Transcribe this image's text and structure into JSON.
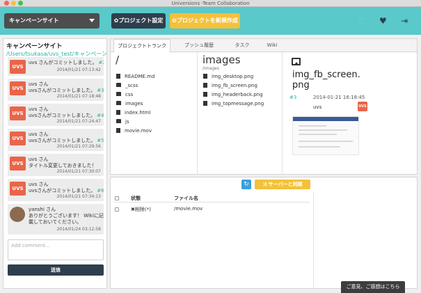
{
  "window": {
    "title": "Universions -Team Collaboration"
  },
  "toolbar": {
    "site_select": "キャンペーンサイト",
    "settings_label": "プロジェクト設定",
    "new_project_label": "プロジェクトを新規作成",
    "icons": [
      "heart-outline-icon",
      "heart-icon",
      "logout-icon"
    ]
  },
  "sidebar": {
    "site_name": "キャンペーンサイト",
    "path": "/Users/tsukasa/uvs_test/キャンペーンサイト",
    "feed": [
      {
        "avatar": "UVS",
        "user": "",
        "message": "uvs さんがコミットしました。",
        "num": "#2",
        "date": "2014/01/21 07:13:42"
      },
      {
        "avatar": "UVS",
        "user": "uvs さん",
        "message": "uvsさんがコミットしました。",
        "num": "#3",
        "date": "2014/01/21 07:18:48"
      },
      {
        "avatar": "UVS",
        "user": "uvs さん",
        "message": "uvsさんがコミットしました。",
        "num": "#4",
        "date": "2014/01/21 07:24:47"
      },
      {
        "avatar": "UVS",
        "user": "uvs さん",
        "message": "uvsさんがコミットしました。",
        "num": "#5",
        "date": "2014/01/21 07:29:56"
      },
      {
        "avatar": "UVS",
        "user": "uvs さん",
        "message": "タイトル変更しておきました！",
        "num": "",
        "date": "2014/01/21 07:30:07"
      },
      {
        "avatar": "UVS",
        "user": "uvs さん",
        "message": "uvsさんがコミットしました。",
        "num": "#6",
        "date": "2014/01/21 07:34:13"
      },
      {
        "avatar": "",
        "user": "yanshi さん",
        "message": "ありがとうございます！ Wikiに記",
        "message2": "載しておいてください。",
        "num": "",
        "date": "2014/01/24 03:12:58"
      }
    ],
    "comment_placeholder": "Add comment...",
    "send_label": "送信"
  },
  "tabs": [
    "プロジェクトトランク",
    "プッシュ履歴",
    "タスク",
    "Wiki"
  ],
  "browser": {
    "col1": {
      "title": "/",
      "items": [
        {
          "name": "README.md",
          "type": "file"
        },
        {
          "name": "_scss",
          "type": "folder"
        },
        {
          "name": "css",
          "type": "folder"
        },
        {
          "name": "images",
          "type": "folder"
        },
        {
          "name": "index.html",
          "type": "file"
        },
        {
          "name": "js",
          "type": "folder"
        },
        {
          "name": "movie.mov",
          "type": "file"
        }
      ]
    },
    "col2": {
      "title": "images",
      "path": "/images",
      "items": [
        {
          "name": "img_desktop.png"
        },
        {
          "name": "img_fb_screen.png"
        },
        {
          "name": "img_headerback.png"
        },
        {
          "name": "img_topmessage.png"
        }
      ]
    },
    "preview": {
      "name_line1": "img_fb_screen.",
      "name_line2": "png",
      "num": "#3",
      "date": "2014-01-21 16:18:45",
      "user": "uvs",
      "avatar": "UVS"
    }
  },
  "changes": {
    "sync_label": "サーバーと同期",
    "col_status": "状態",
    "col_file": "ファイル名",
    "rows": [
      {
        "status": "削除(*)",
        "file": "/movie.mov"
      }
    ]
  },
  "feedback_label": "ご意見、ご感想はこちら",
  "colors": {
    "teal": "#59c9c9",
    "navy": "#2f3e4d",
    "yellow": "#f3c13a",
    "accent_green": "#2bb3a3",
    "uvs_orange": "#e9654a",
    "blue": "#3aa0dc"
  }
}
